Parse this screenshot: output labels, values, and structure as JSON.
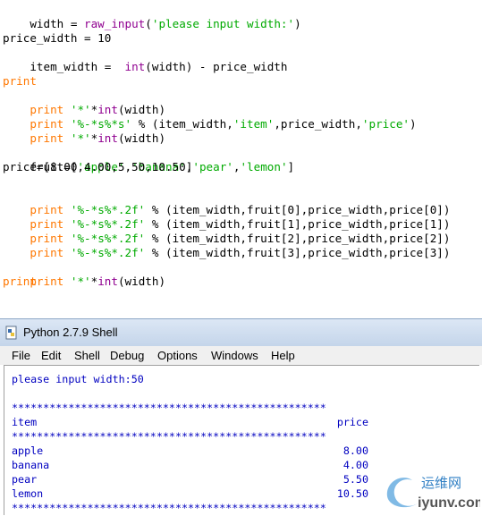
{
  "editor": {
    "l1": [
      "width",
      " = ",
      "raw_input",
      "(",
      "'please input width:'",
      ")"
    ],
    "l3": "price_width = 10",
    "l4a": "item_width =  ",
    "l4b": "int",
    "l4c": "(width) - price_width",
    "print": "print",
    "star": "'*'",
    "starmul": "*",
    "int": "int",
    "widthcall": "(width)",
    "fmt1": "'%-*s%*s'",
    "fmt1rest": " % (item_width,",
    "item": "'item'",
    "fmt1mid": ",price_width,",
    "price": "'price'",
    "fmt1end": ")",
    "fruit_a": "fruit=[",
    "apple": "'apple'",
    "c": ",",
    "banana": "'banana'",
    "pear": "'pear'",
    "lemon": "'lemon'",
    "fruit_end": "]",
    "price_list": "price=[8.00,4.00,5.50,10.50]",
    "fmt2": "'%-*s%*.2f'",
    "row0": " % (item_width,fruit[0],price_width,price[0])",
    "row1": " % (item_width,fruit[1],price_width,price[1])",
    "row2": " % (item_width,fruit[2],price_width,price[2])",
    "row3": " % (item_width,fruit[3],price_width,price[3])"
  },
  "shell": {
    "title": "Python 2.7.9 Shell",
    "menu": [
      "File",
      "Edit",
      "Shell",
      "Debug",
      "Options",
      "Windows",
      "Help"
    ],
    "prompt": "please input width:50",
    "stars": "**************************************************",
    "header_left": "item",
    "header_right": "price",
    "rows": [
      {
        "name": "apple",
        "price": "8.00"
      },
      {
        "name": "banana",
        "price": "4.00"
      },
      {
        "name": "pear",
        "price": "5.50"
      },
      {
        "name": "lemon",
        "price": "10.50"
      }
    ]
  },
  "watermark": {
    "cn": "运维网",
    "domain": "iyunv.com"
  },
  "colors": {
    "keyword": "#ff7700",
    "string": "#00aa00",
    "builtin": "#900090",
    "shell_output": "#0000c0"
  }
}
